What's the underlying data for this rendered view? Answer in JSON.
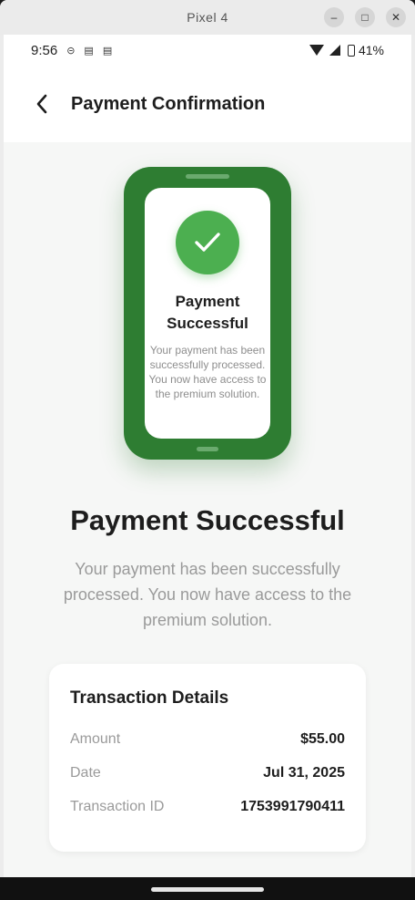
{
  "window": {
    "title": "Pixel 4",
    "min": "–",
    "max": "□",
    "close": "✕"
  },
  "status_bar": {
    "time": "9:56",
    "battery": "41%"
  },
  "app_bar": {
    "title": "Payment Confirmation"
  },
  "illustration": {
    "title": "Payment Successful",
    "message": "Your payment has been successfully processed. You now have access to the premium solution."
  },
  "main": {
    "headline": "Payment Successful",
    "subtext": "Your payment has been successfully processed. You now have access to the premium solution."
  },
  "transaction": {
    "title": "Transaction Details",
    "rows": [
      {
        "label": "Amount",
        "value": "$55.00"
      },
      {
        "label": "Date",
        "value": "Jul 31, 2025"
      },
      {
        "label": "Transaction ID",
        "value": "1753991790411"
      }
    ]
  },
  "colors": {
    "primary_green": "#2e7d32",
    "check_green": "#4caf50"
  }
}
